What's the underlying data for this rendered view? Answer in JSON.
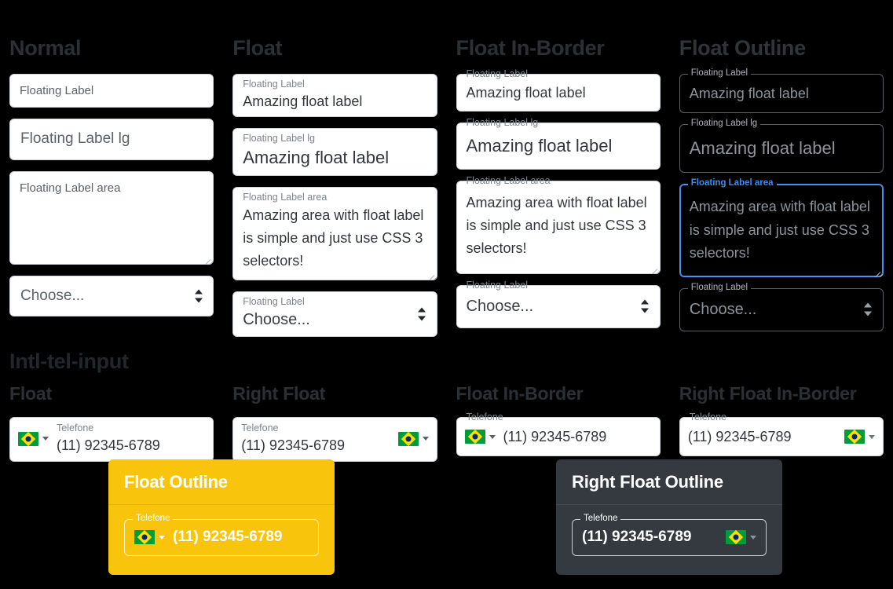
{
  "columns": [
    {
      "title": "Normal",
      "style": "normal",
      "fields": [
        {
          "type": "input",
          "label": "Floating Label",
          "value": "",
          "placeholder": "Floating Label"
        },
        {
          "type": "input-lg",
          "label": "Floating Label lg",
          "value": "",
          "placeholder": "Floating Label lg"
        },
        {
          "type": "textarea",
          "label": "Floating Label area",
          "value": "",
          "placeholder": "Floating Label area"
        },
        {
          "type": "select",
          "label": "Floating Label",
          "value": "Choose...",
          "placeholder": "Choose..."
        }
      ]
    },
    {
      "title": "Float",
      "style": "float",
      "fields": [
        {
          "type": "input",
          "label": "Floating Label",
          "value": "Amazing float label"
        },
        {
          "type": "input-lg",
          "label": "Floating Label lg",
          "value": "Amazing float label"
        },
        {
          "type": "textarea",
          "label": "Floating Label area",
          "value": "Amazing area with float label is simple and just use CSS 3 selectors!"
        },
        {
          "type": "select",
          "label": "Floating Label",
          "value": "Choose..."
        }
      ]
    },
    {
      "title": "Float In-Border",
      "style": "in-border",
      "fields": [
        {
          "type": "input",
          "label": "Floating Label",
          "value": "Amazing float label"
        },
        {
          "type": "input-lg",
          "label": "Floating Label lg",
          "value": "Amazing float label"
        },
        {
          "type": "textarea",
          "label": "Floating Label area",
          "value": "Amazing area with float label is simple and just use CSS 3 selectors!"
        },
        {
          "type": "select",
          "label": "Floating Label",
          "value": "Choose..."
        }
      ]
    },
    {
      "title": "Float Outline",
      "style": "outline",
      "fields": [
        {
          "type": "input",
          "label": "Floating Label",
          "value": "Amazing float label"
        },
        {
          "type": "input-lg",
          "label": "Floating Label lg",
          "value": "Amazing float label"
        },
        {
          "type": "textarea",
          "label": "Floating Label area",
          "value": "Amazing area with float label is simple and just use CSS 3 selectors!",
          "focused": true
        },
        {
          "type": "select",
          "label": "Floating Label",
          "value": "Choose..."
        }
      ]
    }
  ],
  "intl": {
    "section_title": "Intl-tel-input",
    "columns": [
      {
        "title": "Float",
        "label": "Telefone",
        "value": "(11) 92345-6789",
        "flag_side": "left",
        "style": "float"
      },
      {
        "title": "Right Float",
        "label": "Telefone",
        "value": "(11) 92345-6789",
        "flag_side": "right",
        "style": "float"
      },
      {
        "title": "Float In-Border",
        "label": "Telefone",
        "value": "(11) 92345-6789",
        "flag_side": "left",
        "style": "in-border"
      },
      {
        "title": "Right Float In-Border",
        "label": "Telefone",
        "value": "(11) 92345-6789",
        "flag_side": "right",
        "style": "in-border"
      }
    ],
    "cards": [
      {
        "title": "Float Outline",
        "label": "Telefone",
        "value": "(11) 92345-6789",
        "flag_side": "left",
        "bg": "#f8c50c"
      },
      {
        "title": "Right Float Outline",
        "label": "Telefone",
        "value": "(11) 92345-6789",
        "flag_side": "right",
        "bg": "#343a40"
      }
    ]
  },
  "icons": {
    "flag": "brazil-flag-icon",
    "caret": "chevron-down-icon",
    "select_arrows": "select-updown-arrows-icon",
    "resize": "resize-grip-icon"
  },
  "colors": {
    "background": "#000000",
    "heading": "#2b3035",
    "border": "#ced4da",
    "label": "#7c858d",
    "value": "#31373d",
    "focus_blue": "#4a90ee",
    "warning": "#f8c50c",
    "dark": "#343a40"
  }
}
